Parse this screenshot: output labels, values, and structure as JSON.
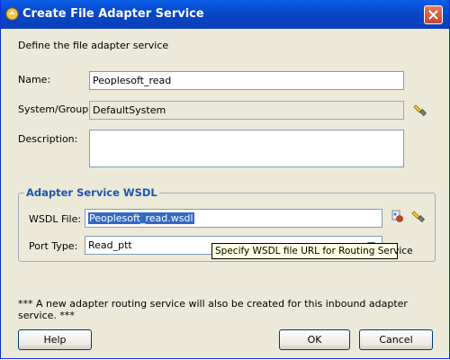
{
  "window": {
    "title": "Create File Adapter Service"
  },
  "intro": "Define the file adapter service",
  "form": {
    "name_label": "Name:",
    "name_value": "Peoplesoft_read",
    "system_label": "System/Group:",
    "system_value": "DefaultSystem",
    "description_label": "Description:",
    "description_value": ""
  },
  "wsdl_group": {
    "title": "Adapter Service WSDL",
    "wsdl_label": "WSDL File:",
    "wsdl_value": "Peoplesoft_read.wsdl",
    "port_label": "Port Type:",
    "port_value": "Read_ptt",
    "tooltip": "Specify WSDL file URL for Routing Service"
  },
  "note": "*** A new adapter routing service will also be created for this inbound adapter service. ***",
  "buttons": {
    "help": "Help",
    "ok": "OK",
    "cancel": "Cancel"
  },
  "icons": {
    "browse": "flashlight-icon",
    "wsdl_service": "service-explorer-icon",
    "close": "close-icon",
    "app": "jdeveloper-icon"
  },
  "colors": {
    "titlebar": "#0a5fe8",
    "group_title": "#1d55b3",
    "selection": "#316ac5",
    "tooltip_bg": "#ffffe1"
  }
}
